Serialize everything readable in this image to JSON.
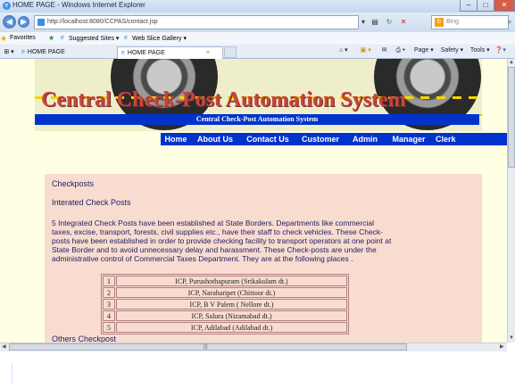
{
  "window": {
    "title": "HOME PAGE - Windows Internet Explorer"
  },
  "address": {
    "url": "http://localhost:8080/CCPAS/contact.jsp",
    "search_placeholder": "Bing"
  },
  "favorites": {
    "label": "Favorites",
    "items": [
      "Suggested Sites ▾",
      "Web Slice Gallery ▾"
    ]
  },
  "tabs": [
    {
      "label": "HOME PAGE"
    },
    {
      "label": "HOME PAGE"
    }
  ],
  "commandbar": {
    "items": [
      "Page ▾",
      "Safety ▾",
      "Tools ▾"
    ]
  },
  "site": {
    "banner_title": "Central Check-Post Automation System",
    "subtitle": "Central Check-Post Automation System",
    "nav": [
      "Home",
      "About Us",
      "Contact Us",
      "Customer",
      "Admin",
      "Manager",
      "Clerk"
    ]
  },
  "content": {
    "heading": "Checkposts",
    "subheading": "Interated Check Posts",
    "paragraph": "5 Integrated Check Posts have been established at State Borders. Departments like commercial taxes, excise, transport, forests, civil supplies etc., have their staff to check vehicles. These Check-posts have been established in order to provide checking facility to transport operators at one point at State Border and to avoid unnecessary delay and harassment. These Check-posts are under the administrative control of Commercial Taxes Department. They are at the following places .",
    "icp_table": [
      {
        "num": "1",
        "name": "ICP, Purushothapuram (Srikakulam dt.)"
      },
      {
        "num": "2",
        "name": "ICP, Naraharipet (Chittoor dt.)"
      },
      {
        "num": "3",
        "name": "ICP, B V Palem ( Nellore dt.)"
      },
      {
        "num": "4",
        "name": "ICP, Salura (Nizamabad dt.)"
      },
      {
        "num": "5",
        "name": "ICP, Adilabad (Adilabad dt.)"
      }
    ],
    "others": "Others Checkpost"
  },
  "colors": {
    "nav_bg": "#0033cc",
    "content_bg": "#f8dcd0",
    "page_bg": "#ffffe3",
    "banner_text": "#c8453f"
  }
}
